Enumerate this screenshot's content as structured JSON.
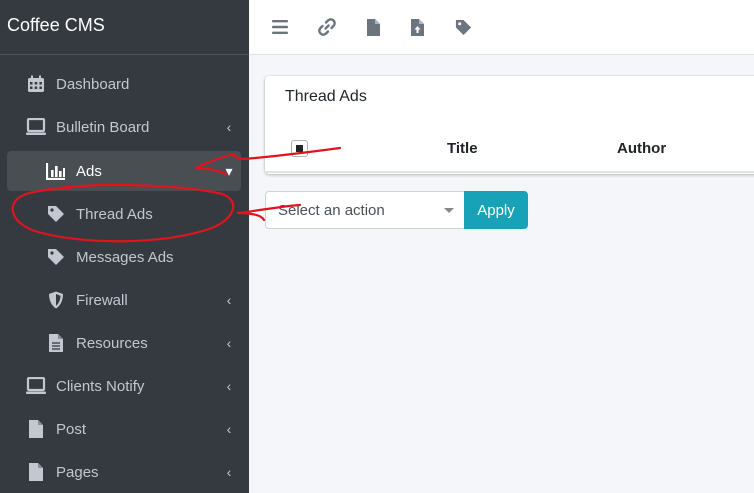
{
  "brand": "Coffee CMS",
  "sidebar": {
    "items": [
      {
        "label": "Dashboard",
        "icon": "calendar-icon",
        "chevron": ""
      },
      {
        "label": "Bulletin Board",
        "icon": "laptop-icon",
        "chevron": "‹"
      },
      {
        "label": "Ads",
        "icon": "chart-bar-icon",
        "chevron": "▾"
      },
      {
        "label": "Thread Ads",
        "icon": "tag-icon",
        "chevron": ""
      },
      {
        "label": "Messages Ads",
        "icon": "tag-icon",
        "chevron": ""
      },
      {
        "label": "Firewall",
        "icon": "shield-icon",
        "chevron": "‹"
      },
      {
        "label": "Resources",
        "icon": "file-icon",
        "chevron": "‹"
      },
      {
        "label": "Clients Notify",
        "icon": "laptop-icon",
        "chevron": "‹"
      },
      {
        "label": "Post",
        "icon": "file-icon",
        "chevron": "‹"
      },
      {
        "label": "Pages",
        "icon": "file-icon",
        "chevron": "‹"
      }
    ]
  },
  "toolbar": {
    "icons": [
      "menu-icon",
      "link-icon",
      "file-icon",
      "file-upload-icon",
      "tag-icon"
    ]
  },
  "main": {
    "card_title": "Thread Ads",
    "columns": [
      "Title",
      "Author"
    ],
    "action_select": {
      "value": "Select an action"
    },
    "apply_label": "Apply"
  },
  "colors": {
    "sidebar_bg": "#343a40",
    "active_item_bg": "#494e53",
    "apply_button": "#17a2b8",
    "annotation": "#e0141e"
  }
}
